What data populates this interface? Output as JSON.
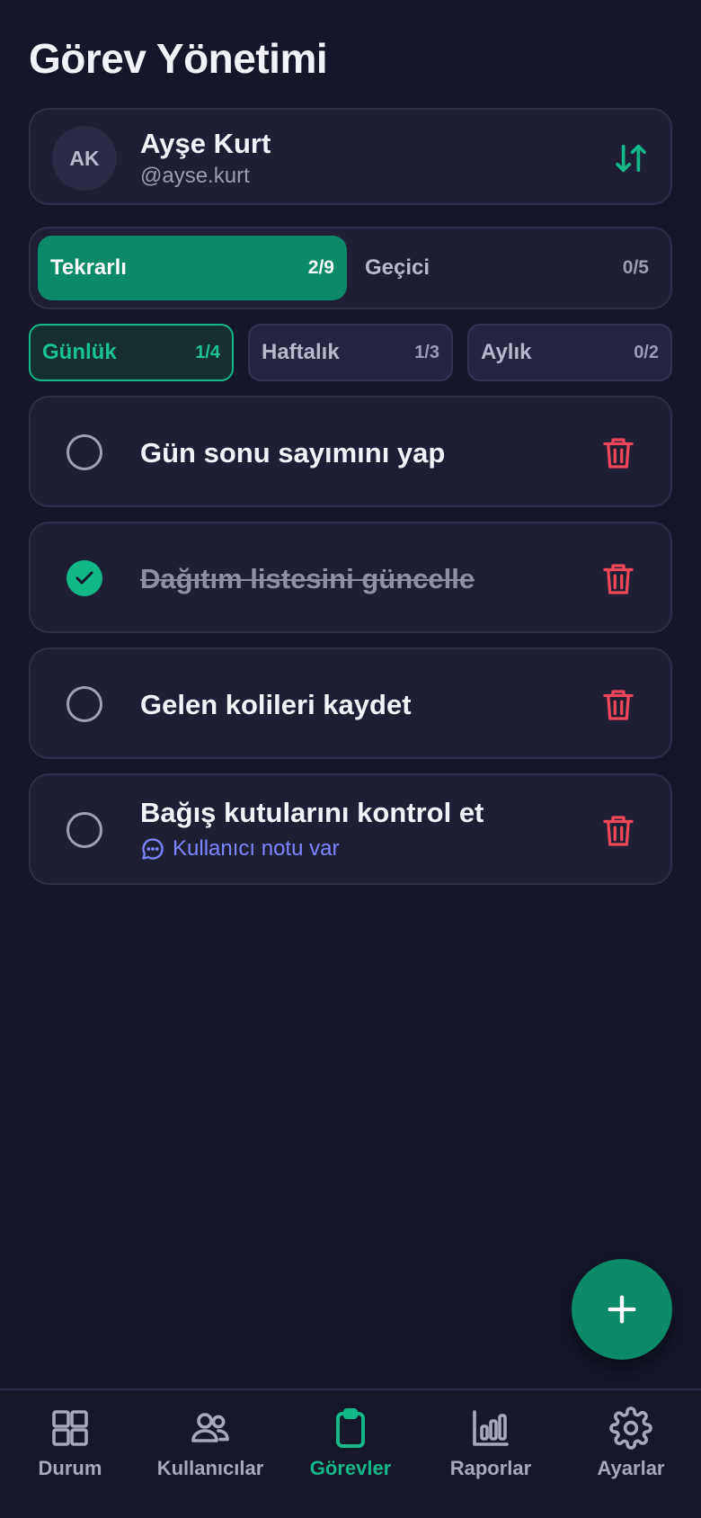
{
  "header": {
    "title": "Görev Yönetimi"
  },
  "user": {
    "initials": "AK",
    "name": "Ayşe Kurt",
    "handle": "@ayse.kurt",
    "swap_icon": "sort-arrows-icon"
  },
  "type_tabs": [
    {
      "label": "Tekrarlı",
      "count": "2/9",
      "active": true
    },
    {
      "label": "Geçici",
      "count": "0/5",
      "active": false
    }
  ],
  "period_tabs": [
    {
      "label": "Günlük",
      "count": "1/4",
      "active": true
    },
    {
      "label": "Haftalık",
      "count": "1/3",
      "active": false
    },
    {
      "label": "Aylık",
      "count": "0/2",
      "active": false
    }
  ],
  "tasks": [
    {
      "title": "Gün sonu sayımını yap",
      "done": false
    },
    {
      "title": "Dağıtım listesini güncelle",
      "done": true
    },
    {
      "title": "Gelen kolileri kaydet",
      "done": false
    },
    {
      "title": "Bağış kutularını kontrol et",
      "done": false,
      "note": "Kullanıcı notu var"
    }
  ],
  "fab": {
    "icon": "plus-icon"
  },
  "bottom_nav": [
    {
      "label": "Durum",
      "icon": "grid-icon",
      "active": false
    },
    {
      "label": "Kullanıcılar",
      "icon": "users-icon",
      "active": false
    },
    {
      "label": "Görevler",
      "icon": "clipboard-icon",
      "active": true
    },
    {
      "label": "Raporlar",
      "icon": "bar-chart-icon",
      "active": false
    },
    {
      "label": "Ayarlar",
      "icon": "gear-icon",
      "active": false
    }
  ],
  "colors": {
    "background": "#151628",
    "card": "#1e1f35",
    "accent": "#0a8a66",
    "accent_text": "#19c28f",
    "delete": "#f0465a",
    "note": "#7d86ff"
  }
}
